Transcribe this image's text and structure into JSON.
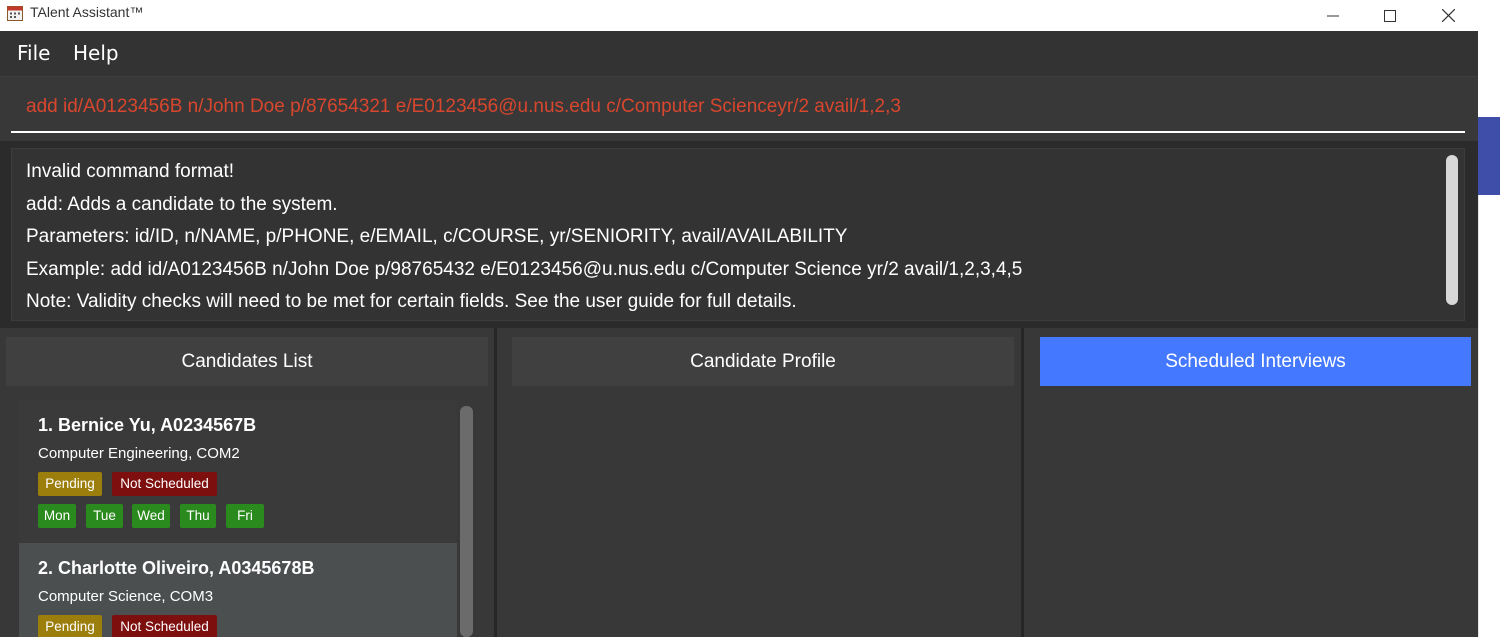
{
  "window": {
    "title": "TAlent Assistant™",
    "icon": "calendar-app-icon"
  },
  "menu": {
    "file": "File",
    "help": "Help"
  },
  "command": {
    "value": "add id/A0123456B n/John Doe p/87654321 e/E0123456@u.nus.edu c/Computer Scienceyr/2 avail/1,2,3",
    "error_color": "#d8462d"
  },
  "result": {
    "lines": [
      "Invalid command format!",
      "add: Adds a candidate to the system.",
      "Parameters: id/ID, n/NAME, p/PHONE, e/EMAIL, c/COURSE, yr/SENIORITY, avail/AVAILABILITY",
      "Example: add id/A0123456B n/John Doe p/98765432 e/E0123456@u.nus.edu c/Computer Science yr/2 avail/1,2,3,4,5",
      "Note: Validity checks will need to be met for certain fields. See the user guide for full details."
    ]
  },
  "panels": {
    "candidates_list": "Candidates List",
    "candidate_profile": "Candidate Profile",
    "scheduled_interviews": "Scheduled Interviews",
    "active_color": "#4479ff"
  },
  "candidates": [
    {
      "name": "1.  Bernice Yu, A0234567B",
      "course": "Computer Engineering, COM2",
      "status": "Pending",
      "interview": "Not Scheduled",
      "days": [
        "Mon",
        "Tue",
        "Wed",
        "Thu",
        "Fri"
      ]
    },
    {
      "name": "2.  Charlotte Oliveiro, A0345678B",
      "course": "Computer Science, COM3",
      "status": "Pending",
      "interview": "Not Scheduled"
    }
  ],
  "colors": {
    "pending": "#9b7e0c",
    "not_scheduled": "#7d0f0f",
    "available_day": "#2b8a1d"
  }
}
